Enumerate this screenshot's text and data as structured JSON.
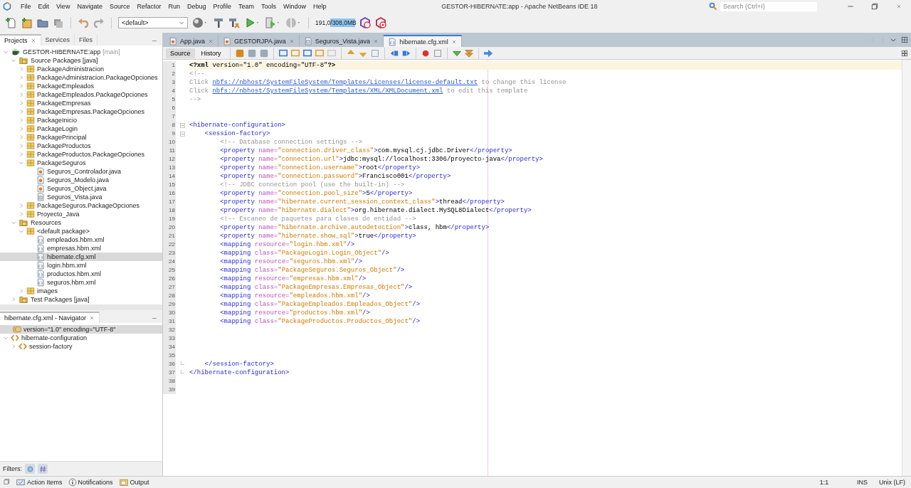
{
  "window": {
    "title": "GESTOR-HIBERNATE:app - Apache NetBeans IDE 18",
    "search_placeholder": "Search (Ctrl+I)"
  },
  "menu": [
    "File",
    "Edit",
    "View",
    "Navigate",
    "Source",
    "Refactor",
    "Run",
    "Debug",
    "Profile",
    "Team",
    "Tools",
    "Window",
    "Help"
  ],
  "toolbar": {
    "configuration": "<default>",
    "memory": {
      "reading": "191,0/308,0MB",
      "level": 0.62
    }
  },
  "projects": {
    "tabs": [
      {
        "label": "Projects",
        "selected": true
      },
      {
        "label": "Services",
        "selected": false
      },
      {
        "label": "Files",
        "selected": false
      }
    ],
    "tree": [
      {
        "kind": "project",
        "label": "GESTOR-HIBERNATE:app",
        "note": "[main]",
        "expanded": true,
        "selected": false,
        "children": [
          {
            "kind": "source-root",
            "label": "Source Packages [java]",
            "expanded": true,
            "selected": false,
            "children": [
              {
                "kind": "package",
                "label": "PackageAdministracion",
                "expanded": false,
                "selected": false
              },
              {
                "kind": "package",
                "label": "PackageAdministracion.PackageOpciones",
                "expanded": false,
                "selected": false
              },
              {
                "kind": "package",
                "label": "PackageEmpleados",
                "expanded": false,
                "selected": false
              },
              {
                "kind": "package",
                "label": "PackageEmpleados.PackageOpciones",
                "expanded": false,
                "selected": false
              },
              {
                "kind": "package",
                "label": "PackageEmpresas",
                "expanded": false,
                "selected": false
              },
              {
                "kind": "package",
                "label": "PackageEmpresas.PackageOpciones",
                "expanded": false,
                "selected": false
              },
              {
                "kind": "package",
                "label": "PackageInicio",
                "expanded": false,
                "selected": false
              },
              {
                "kind": "package",
                "label": "PackageLogin",
                "expanded": false,
                "selected": false
              },
              {
                "kind": "package",
                "label": "PackagePrincipal",
                "expanded": false,
                "selected": false
              },
              {
                "kind": "package",
                "label": "PackageProductos",
                "expanded": false,
                "selected": false
              },
              {
                "kind": "package",
                "label": "PackageProductos.PackageOpciones",
                "expanded": false,
                "selected": false
              },
              {
                "kind": "package",
                "label": "PackageSeguros",
                "expanded": true,
                "selected": false,
                "children": [
                  {
                    "kind": "java",
                    "label": "Seguros_Controlador.java",
                    "selected": false
                  },
                  {
                    "kind": "java",
                    "label": "Seguros_Modelo.java",
                    "selected": false
                  },
                  {
                    "kind": "java",
                    "label": "Seguros_Object.java",
                    "selected": false
                  },
                  {
                    "kind": "form",
                    "label": "Seguros_Vista.java",
                    "selected": false
                  }
                ]
              },
              {
                "kind": "package",
                "label": "PackageSeguros.PackageOpciones",
                "expanded": false,
                "selected": false
              },
              {
                "kind": "package",
                "label": "Proyecto_Java",
                "expanded": false,
                "selected": false
              }
            ]
          },
          {
            "kind": "source-root",
            "label": "Resources",
            "expanded": true,
            "selected": false,
            "children": [
              {
                "kind": "package",
                "label": "<default package>",
                "expanded": true,
                "selected": false,
                "children": [
                  {
                    "kind": "xml",
                    "label": "empleados.hbm.xml",
                    "selected": false
                  },
                  {
                    "kind": "xml",
                    "label": "empresas.hbm.xml",
                    "selected": false
                  },
                  {
                    "kind": "xml",
                    "label": "hibernate.cfg.xml",
                    "selected": true
                  },
                  {
                    "kind": "xml",
                    "label": "login.hbm.xml",
                    "selected": false
                  },
                  {
                    "kind": "xml",
                    "label": "productos.hbm.xml",
                    "selected": false
                  },
                  {
                    "kind": "xml",
                    "label": "seguros.hbm.xml",
                    "selected": false
                  }
                ]
              },
              {
                "kind": "package",
                "label": "images",
                "expanded": false,
                "selected": false
              }
            ]
          },
          {
            "kind": "source-root",
            "label": "Test Packages [java]",
            "expanded": false,
            "selected": false
          }
        ]
      }
    ]
  },
  "navigator": {
    "title": "hibernate.cfg.xml - Navigator",
    "filters_label": "Filters:",
    "tree": [
      {
        "kind": "declaration",
        "label": "version=\"1.0\" encoding=\"UTF-8\"",
        "selected": true
      },
      {
        "kind": "element",
        "label": "hibernate-configuration",
        "expanded": true,
        "selected": false,
        "children": [
          {
            "kind": "element",
            "label": "session-factory",
            "expanded": false,
            "selected": false
          }
        ]
      }
    ]
  },
  "editor": {
    "tabs": [
      {
        "label": "App.java",
        "kind": "java",
        "selected": false
      },
      {
        "label": "GESTORJPA.java",
        "kind": "java",
        "selected": false
      },
      {
        "label": "Seguros_Vista.java",
        "kind": "form",
        "selected": false
      },
      {
        "label": "hibernate.cfg.xml",
        "kind": "xml",
        "selected": true
      }
    ],
    "views": [
      {
        "label": "Source",
        "selected": true
      },
      {
        "label": "History",
        "selected": false
      }
    ],
    "lines": [
      {
        "number": "1",
        "current": true,
        "tokens": [
          {
            "kind": "pi",
            "text": "<?xml"
          },
          {
            "kind": "text",
            "text": " version=\"1.0\" encoding=\"UTF-8\""
          },
          {
            "kind": "pi",
            "text": "?>"
          }
        ]
      },
      {
        "number": "2",
        "current": false,
        "tokens": [
          {
            "kind": "comment",
            "text": "<!--"
          }
        ]
      },
      {
        "number": "3",
        "current": false,
        "tokens": [
          {
            "kind": "comment",
            "text": "Click "
          },
          {
            "kind": "link",
            "text": "nbfs://nbhost/SystemFileSystem/Templates/Licenses/license-default.txt"
          },
          {
            "kind": "comment",
            "text": " to change this license"
          }
        ]
      },
      {
        "number": "4",
        "current": false,
        "tokens": [
          {
            "kind": "comment",
            "text": "Click "
          },
          {
            "kind": "link",
            "text": "nbfs://nbhost/SystemFileSystem/Templates/XML/XMLDocument.xml"
          },
          {
            "kind": "comment",
            "text": " to edit this template"
          }
        ]
      },
      {
        "number": "5",
        "current": false,
        "tokens": [
          {
            "kind": "comment",
            "text": "-->"
          }
        ]
      },
      {
        "number": "6",
        "current": false
      },
      {
        "number": "7",
        "current": false
      },
      {
        "number": "8",
        "current": false,
        "expanded": true,
        "tokens": [
          {
            "kind": "tag",
            "text": "<hibernate-configuration>"
          }
        ]
      },
      {
        "number": "9",
        "current": false,
        "expanded": true,
        "tokens": [
          {
            "kind": "tag",
            "text": "    <session-factory>"
          }
        ]
      },
      {
        "number": "10",
        "current": false,
        "tokens": [
          {
            "kind": "comment",
            "text": "        <!-- Database connection settings -->"
          }
        ]
      },
      {
        "number": "11",
        "current": false,
        "tokens": [
          {
            "kind": "tag",
            "text": "        <property "
          },
          {
            "kind": "attr",
            "text": "name="
          },
          {
            "kind": "value",
            "text": "\"connection.driver_class\""
          },
          {
            "kind": "tag",
            "text": ">"
          },
          {
            "kind": "text",
            "text": "com.mysql.cj.jdbc.Driver"
          },
          {
            "kind": "tag",
            "text": "</property>"
          }
        ]
      },
      {
        "number": "12",
        "current": false,
        "tokens": [
          {
            "kind": "tag",
            "text": "        <property "
          },
          {
            "kind": "attr",
            "text": "name="
          },
          {
            "kind": "value",
            "text": "\"connection.url\""
          },
          {
            "kind": "tag",
            "text": ">"
          },
          {
            "kind": "text",
            "text": "jdbc:mysql://localhost:3306/proyecto-java"
          },
          {
            "kind": "tag",
            "text": "</property>"
          }
        ]
      },
      {
        "number": "13",
        "current": false,
        "tokens": [
          {
            "kind": "tag",
            "text": "        <property "
          },
          {
            "kind": "attr",
            "text": "name="
          },
          {
            "kind": "value",
            "text": "\"connection.username\""
          },
          {
            "kind": "tag",
            "text": ">"
          },
          {
            "kind": "text",
            "text": "root"
          },
          {
            "kind": "tag",
            "text": "</property>"
          }
        ]
      },
      {
        "number": "14",
        "current": false,
        "tokens": [
          {
            "kind": "tag",
            "text": "        <property "
          },
          {
            "kind": "attr",
            "text": "name="
          },
          {
            "kind": "value",
            "text": "\"connection.password\""
          },
          {
            "kind": "tag",
            "text": ">"
          },
          {
            "kind": "text",
            "text": "Francisco001"
          },
          {
            "kind": "tag",
            "text": "</property>"
          }
        ]
      },
      {
        "number": "15",
        "current": false,
        "tokens": [
          {
            "kind": "comment",
            "text": "        <!-- JDBC connection pool (use the built-in) -->"
          }
        ]
      },
      {
        "number": "16",
        "current": false,
        "tokens": [
          {
            "kind": "tag",
            "text": "        <property "
          },
          {
            "kind": "attr",
            "text": "name="
          },
          {
            "kind": "value",
            "text": "\"connection.pool_size\""
          },
          {
            "kind": "tag",
            "text": ">"
          },
          {
            "kind": "text",
            "text": "5"
          },
          {
            "kind": "tag",
            "text": "</property>"
          }
        ]
      },
      {
        "number": "17",
        "current": false,
        "tokens": [
          {
            "kind": "tag",
            "text": "        <property "
          },
          {
            "kind": "attr",
            "text": "name="
          },
          {
            "kind": "value",
            "text": "\"hibernate.current_session_context_class\""
          },
          {
            "kind": "tag",
            "text": ">"
          },
          {
            "kind": "text",
            "text": "thread"
          },
          {
            "kind": "tag",
            "text": "</property>"
          }
        ]
      },
      {
        "number": "18",
        "current": false,
        "tokens": [
          {
            "kind": "tag",
            "text": "        <property "
          },
          {
            "kind": "attr",
            "text": "name="
          },
          {
            "kind": "value",
            "text": "\"hibernate.dialect\""
          },
          {
            "kind": "tag",
            "text": ">"
          },
          {
            "kind": "text",
            "text": "org.hibernate.dialect.MySQL8Dialect"
          },
          {
            "kind": "tag",
            "text": "</property>"
          }
        ]
      },
      {
        "number": "19",
        "current": false,
        "tokens": [
          {
            "kind": "comment",
            "text": "        <!-- Escaneo de paquetes para clases de entidad -->"
          }
        ]
      },
      {
        "number": "20",
        "current": false,
        "tokens": [
          {
            "kind": "tag",
            "text": "        <property "
          },
          {
            "kind": "attr",
            "text": "name="
          },
          {
            "kind": "value",
            "text": "\"hibernate.archive.autodetection\""
          },
          {
            "kind": "tag",
            "text": ">"
          },
          {
            "kind": "text",
            "text": "class, hbm"
          },
          {
            "kind": "tag",
            "text": "</property>"
          }
        ]
      },
      {
        "number": "21",
        "current": false,
        "tokens": [
          {
            "kind": "tag",
            "text": "        <property "
          },
          {
            "kind": "attr",
            "text": "name="
          },
          {
            "kind": "value",
            "text": "\"hibernate.show_sql\""
          },
          {
            "kind": "tag",
            "text": ">"
          },
          {
            "kind": "text",
            "text": "true"
          },
          {
            "kind": "tag",
            "text": "</property>"
          }
        ]
      },
      {
        "number": "22",
        "current": false,
        "tokens": [
          {
            "kind": "tag",
            "text": "        <mapping "
          },
          {
            "kind": "attr",
            "text": "resource="
          },
          {
            "kind": "value",
            "text": "\"login.hbm.xml\""
          },
          {
            "kind": "tag",
            "text": "/>"
          }
        ]
      },
      {
        "number": "23",
        "current": false,
        "tokens": [
          {
            "kind": "tag",
            "text": "        <mapping "
          },
          {
            "kind": "attr",
            "text": "class="
          },
          {
            "kind": "value",
            "text": "\"PackageLogin.Login_Object\""
          },
          {
            "kind": "tag",
            "text": "/>"
          }
        ]
      },
      {
        "number": "24",
        "current": false,
        "tokens": [
          {
            "kind": "tag",
            "text": "        <mapping "
          },
          {
            "kind": "attr",
            "text": "resource="
          },
          {
            "kind": "value",
            "text": "\"seguros.hbm.xml\""
          },
          {
            "kind": "tag",
            "text": "/>"
          }
        ]
      },
      {
        "number": "25",
        "current": false,
        "tokens": [
          {
            "kind": "tag",
            "text": "        <mapping "
          },
          {
            "kind": "attr",
            "text": "class="
          },
          {
            "kind": "value",
            "text": "\"PackageSeguros.Seguros_Object\""
          },
          {
            "kind": "tag",
            "text": "/>"
          }
        ]
      },
      {
        "number": "26",
        "current": false,
        "tokens": [
          {
            "kind": "tag",
            "text": "        <mapping "
          },
          {
            "kind": "attr",
            "text": "resource="
          },
          {
            "kind": "value",
            "text": "\"empresas.hbm.xml\""
          },
          {
            "kind": "tag",
            "text": "/>"
          }
        ]
      },
      {
        "number": "27",
        "current": false,
        "tokens": [
          {
            "kind": "tag",
            "text": "        <mapping "
          },
          {
            "kind": "attr",
            "text": "class="
          },
          {
            "kind": "value",
            "text": "\"PackageEmpresas.Empresas_Object\""
          },
          {
            "kind": "tag",
            "text": "/>"
          }
        ]
      },
      {
        "number": "28",
        "current": false,
        "tokens": [
          {
            "kind": "tag",
            "text": "        <mapping "
          },
          {
            "kind": "attr",
            "text": "resource="
          },
          {
            "kind": "value",
            "text": "\"empleados.hbm.xml\""
          },
          {
            "kind": "tag",
            "text": "/>"
          }
        ]
      },
      {
        "number": "29",
        "current": false,
        "tokens": [
          {
            "kind": "tag",
            "text": "        <mapping "
          },
          {
            "kind": "attr",
            "text": "class="
          },
          {
            "kind": "value",
            "text": "\"PackageEmpleados.Empleados_Object\""
          },
          {
            "kind": "tag",
            "text": "/>"
          }
        ]
      },
      {
        "number": "30",
        "current": false,
        "tokens": [
          {
            "kind": "tag",
            "text": "        <mapping "
          },
          {
            "kind": "attr",
            "text": "resource="
          },
          {
            "kind": "value",
            "text": "\"productos.hbm.xml\""
          },
          {
            "kind": "tag",
            "text": "/>"
          }
        ]
      },
      {
        "number": "31",
        "current": false,
        "tokens": [
          {
            "kind": "tag",
            "text": "        <mapping "
          },
          {
            "kind": "attr",
            "text": "class="
          },
          {
            "kind": "value",
            "text": "\"PackageProductos.Productos_Object\""
          },
          {
            "kind": "tag",
            "text": "/>"
          }
        ]
      },
      {
        "number": "32",
        "current": false
      },
      {
        "number": "33",
        "current": false
      },
      {
        "number": "34",
        "current": false
      },
      {
        "number": "35",
        "current": false
      },
      {
        "number": "36",
        "current": false,
        "fold_end": true,
        "tokens": [
          {
            "kind": "tag",
            "text": "    </session-factory>"
          }
        ]
      },
      {
        "number": "37",
        "current": false,
        "fold_end": true,
        "tokens": [
          {
            "kind": "tag",
            "text": "</hibernate-configuration>"
          }
        ]
      },
      {
        "number": "38",
        "current": false
      },
      {
        "number": "39",
        "current": false
      }
    ]
  },
  "status_bar": {
    "items": [
      {
        "kind": "tasks",
        "label": "Action Items"
      },
      {
        "kind": "notifications",
        "label": "Notifications"
      },
      {
        "kind": "output",
        "label": "Output"
      }
    ],
    "position": "1:1",
    "mode": "INS",
    "line_endings": "Unix (LF)"
  }
}
